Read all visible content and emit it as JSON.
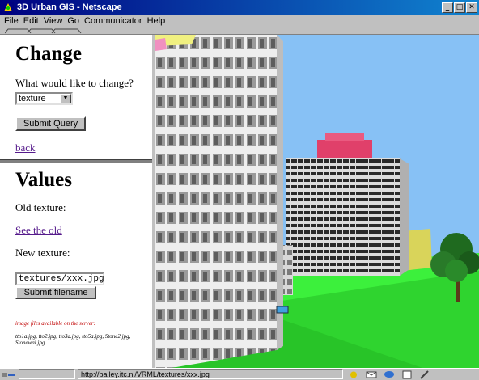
{
  "window": {
    "title": "3D Urban GIS - Netscape",
    "buttons": {
      "minimize": "_",
      "maximize": "□",
      "close": "✕"
    }
  },
  "menu": [
    "File",
    "Edit",
    "View",
    "Go",
    "Communicator",
    "Help"
  ],
  "change_frame": {
    "heading": "Change",
    "prompt": "What would like to change?",
    "select_value": "texture",
    "submit_label": "Submit Query",
    "back_link": "back"
  },
  "values_frame": {
    "heading": "Values",
    "old_label": "Old texture:",
    "see_old_link": "See the old",
    "new_label": "New texture:",
    "filename_value": "textures/xxx.jpg",
    "submit_label": "Submit filename",
    "files_note": "image files available on the server:",
    "files_list": "tto1a.jpg, tto2.jpg, tto3a.jpg, tto5a.jpg, Stone2.jpg, Stonewal.jpg"
  },
  "status": {
    "url": "http://bailey.itc.nl/VRML/textures/xxx.jpg"
  },
  "icons": {
    "app": "netscape-icon",
    "status": "security-icon"
  },
  "colors": {
    "titlebar": "#000080",
    "visited_link": "#551a8b",
    "note_red": "#c00000",
    "sky": "#87c1f5",
    "grass": "#3cf03c"
  }
}
